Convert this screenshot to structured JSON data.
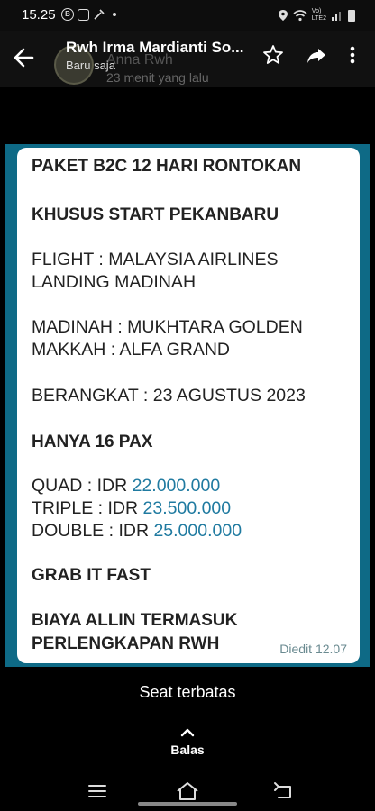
{
  "status_bar": {
    "time": "15.25",
    "b_badge": "B",
    "network_label_top": "Vo)",
    "network_label_bottom": "LTE2"
  },
  "header": {
    "title": "Rwh Irma Mardianti So...",
    "subtitle": "Baru saja",
    "ghost_name": "Anna Rwh",
    "ghost_time": "23 menit yang lalu"
  },
  "status_image": {
    "lines": [
      "PAKET B2C 12 HARI RONTOKAN",
      "KHUSUS START PEKANBARU",
      "FLIGHT : MALAYSIA AIRLINES",
      "LANDING MADINAH",
      "MADINAH : MUKHTARA GOLDEN",
      "MAKKAH : ALFA GRAND",
      "BERANGKAT : 23 AGUSTUS 2023",
      "HANYA 16 PAX",
      "GRAB IT FAST",
      "BIAYA ALLIN TERMASUK",
      "PERLENGKAPAN RWH"
    ],
    "prices": [
      {
        "label": "QUAD : IDR ",
        "amount": "22.000.000"
      },
      {
        "label": "TRIPLE : IDR ",
        "amount": "23.500.000"
      },
      {
        "label": "DOUBLE : IDR ",
        "amount": "25.000.000"
      }
    ],
    "edited": "Diedit 12.07"
  },
  "caption": "Seat terbatas",
  "reply": {
    "label": "Balas"
  },
  "colors": {
    "card_border": "#0e6a86",
    "price_text": "#1f7aa0"
  },
  "icons": [
    "back-arrow-icon",
    "star-icon",
    "share-icon",
    "more-vert-icon",
    "chevron-up-icon",
    "recents-icon",
    "home-icon",
    "back-nav-icon"
  ]
}
